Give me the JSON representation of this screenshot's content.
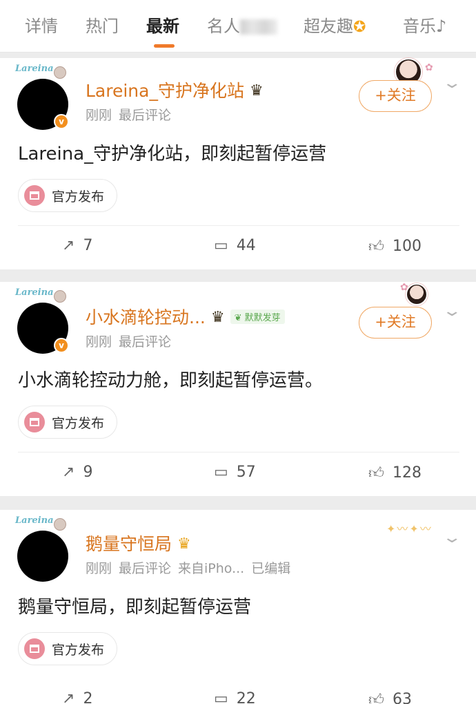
{
  "tabs": [
    {
      "label": "详情",
      "active": false
    },
    {
      "label": "热门",
      "active": false
    },
    {
      "label": "最新",
      "active": true
    },
    {
      "label": "名人",
      "active": false
    },
    {
      "label": "超友趣",
      "active": false
    },
    {
      "label": "音乐",
      "active": false
    }
  ],
  "icons": {
    "follow_plus": "plus-icon",
    "more": "chevron-down-icon",
    "repost": "repost-icon",
    "comment": "comment-icon",
    "like": "like-icon"
  },
  "colors": {
    "accent": "#f07a2a",
    "name": "#d8751f",
    "follow_border": "#f0a865",
    "verified": "#f28f1e",
    "chip_icon": "#e98d9a"
  },
  "avatar_deco_text": "Lareina",
  "posts": [
    {
      "username": "Lareina_守护净化站",
      "meta": [
        "刚刚",
        "最后评论"
      ],
      "follow_label": "+关注",
      "content": "Lareina_守护净化站，即刻起暂停运营",
      "source": "官方发布",
      "reposts": "7",
      "comments": "44",
      "likes": "100"
    },
    {
      "username": "小水滴轮控动...",
      "badge": "默默发芽",
      "meta": [
        "刚刚",
        "最后评论"
      ],
      "follow_label": "+关注",
      "content": "小水滴轮控动力舱，即刻起暂停运营。",
      "source": "官方发布",
      "reposts": "9",
      "comments": "57",
      "likes": "128"
    },
    {
      "username": "鹅量守恒局",
      "meta": [
        "刚刚",
        "最后评论",
        "来自iPho...",
        "已编辑"
      ],
      "content": "鹅量守恒局，即刻起暂停运营",
      "source": "官方发布",
      "reposts": "2",
      "comments": "22",
      "likes": "63"
    }
  ]
}
